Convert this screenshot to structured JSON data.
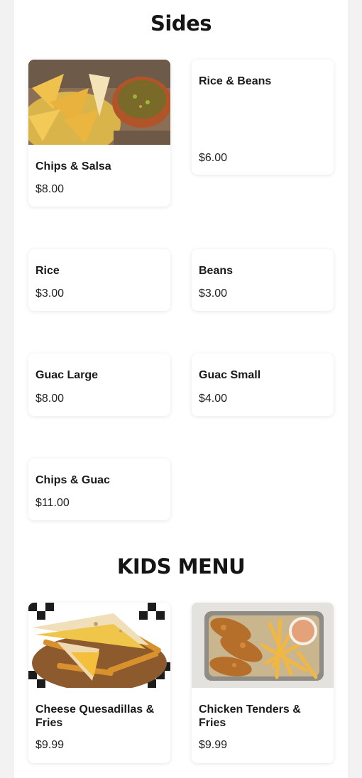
{
  "sections": [
    {
      "title": "Sides",
      "items": [
        {
          "name": "Chips & Salsa",
          "price": "$8.00"
        },
        {
          "name": "Rice & Beans",
          "price": "$6.00"
        },
        {
          "name": "Rice",
          "price": "$3.00"
        },
        {
          "name": "Beans",
          "price": "$3.00"
        },
        {
          "name": "Guac Large",
          "price": "$8.00"
        },
        {
          "name": "Guac Small",
          "price": "$4.00"
        },
        {
          "name": "Chips & Guac",
          "price": "$11.00"
        }
      ]
    },
    {
      "title": "KIDS MENU",
      "items": [
        {
          "name": "Cheese Quesadillas & Fries",
          "price": "$9.99"
        },
        {
          "name": "Chicken Tenders & Fries",
          "price": "$9.99"
        }
      ]
    }
  ]
}
